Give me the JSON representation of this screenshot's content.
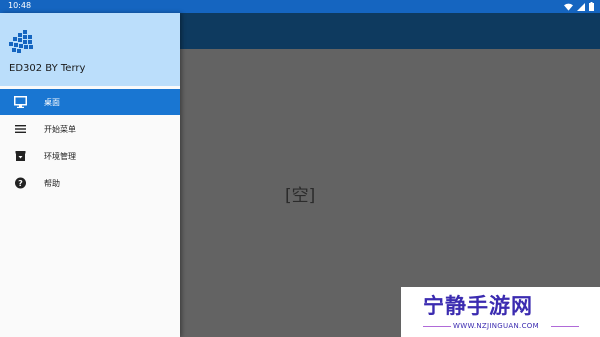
{
  "status_bar": {
    "time": "10:48",
    "icons": [
      "wifi-icon",
      "signal-icon",
      "battery-icon"
    ]
  },
  "colors": {
    "status_bar": "#1565c0",
    "drawer_header": "#bbdefb",
    "active_item": "#1976d2",
    "app_bar_dimmed": "#0e3a5f",
    "content_dimmed": "#636363"
  },
  "drawer": {
    "title": "ED302 BY Terry",
    "items": [
      {
        "label": "桌面",
        "icon": "monitor-icon",
        "active": true
      },
      {
        "label": "开始菜单",
        "icon": "menu-lines-icon",
        "active": false
      },
      {
        "label": "环境管理",
        "icon": "archive-icon",
        "active": false
      },
      {
        "label": "帮助",
        "icon": "help-icon",
        "active": false
      }
    ]
  },
  "main": {
    "empty_label": "[空]"
  },
  "watermark": {
    "title": "宁静手游网",
    "url": "WWW.NZJINGUAN.COM"
  }
}
